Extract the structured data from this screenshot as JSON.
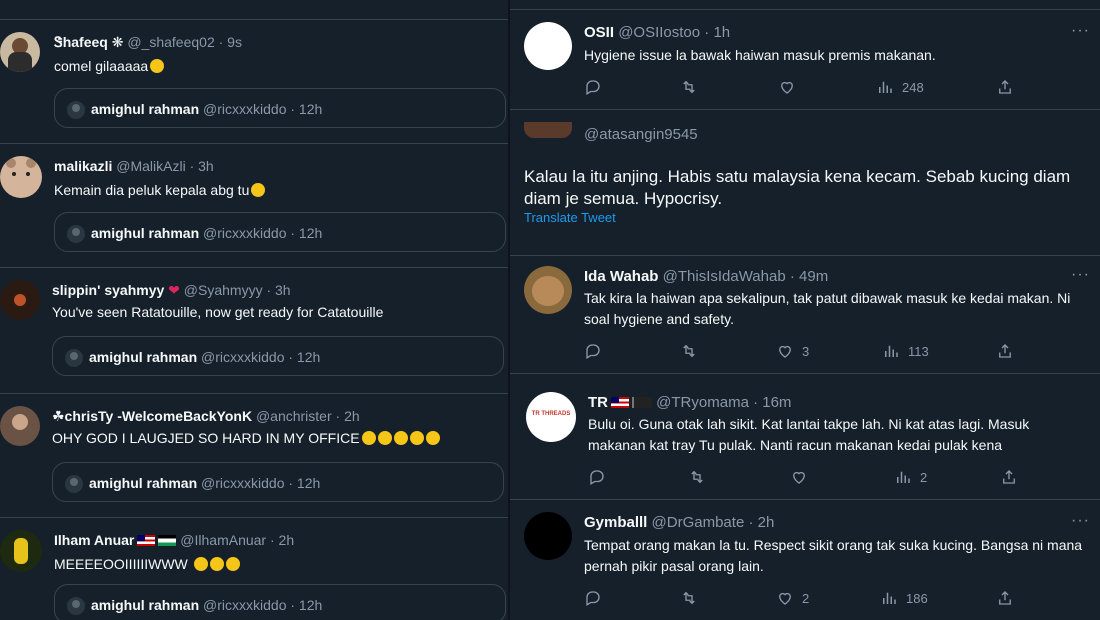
{
  "left_tweets": [
    {
      "name": "Ꮥhafeeq ❋",
      "handle": "@_shafeeq02 · 9s",
      "text": "comel gilaaaaa",
      "quote": {
        "name": "amighul rahman",
        "handle": "@ricxxxkiddo · 12h"
      }
    },
    {
      "name": "malikazli",
      "handle": "@MalikAzli · 3h",
      "text": "Kemain dia peluk kepala abg tu",
      "quote": {
        "name": "amighul rahman",
        "handle": "@ricxxxkiddo · 12h"
      }
    },
    {
      "name": "slippin' syahmyy",
      "handle": "@Syahmyyy · 3h",
      "text": "You've seen Ratatouille, now get ready for Catatouille",
      "quote": {
        "name": "amighul rahman",
        "handle": "@ricxxxkiddo · 12h"
      }
    },
    {
      "name": "☘chrisTy -WelcomeBackYonK",
      "handle": "@anchrister · 2h",
      "text": "OHY GOD I LAUGJED SO HARD IN MY OFFICE",
      "quote": {
        "name": "amighul rahman",
        "handle": "@ricxxxkiddo · 12h"
      }
    },
    {
      "name": "Ilham Anuar",
      "handle": "@IlhamAnuar · 2h",
      "text": "MEEEEOOIIIIIIWWW",
      "quote": {
        "name": "amighul rahman",
        "handle": "@ricxxxkiddo · 12h"
      }
    }
  ],
  "right": {
    "t1": {
      "name": "OSII",
      "handle": "@OSIIostoo · 1h",
      "text": "Hygiene issue la bawak haiwan masuk premis makanan.",
      "views": "248"
    },
    "t2": {
      "handle": "@atasangin9545",
      "text": "Kalau la itu anjing. Habis satu malaysia kena kecam. Sebab kucing diam diam je semua. Hypocrisy.",
      "translate": "Translate Tweet"
    },
    "t3": {
      "name": "Ida Wahab",
      "handle": "@ThisIsIdaWahab · 49m",
      "text": "Tak kira la haiwan apa sekalipun, tak patut dibawak masuk ke kedai makan. Ni soal hygiene and safety.",
      "likes": "3",
      "views": "113"
    },
    "t4": {
      "name": "TR",
      "handle": "@TRyomama · 16m",
      "avatar_text": "TR THREADS",
      "text": "Bulu oi. Guna otak lah sikit. Kat lantai takpe lah. Ni kat atas lagi. Masuk makanan kat tray Tu pulak. Nanti racun makanan kedai pulak kena",
      "views": "2"
    },
    "t5": {
      "name": "Gymballl",
      "handle": "@DrGambate · 2h",
      "text": "Tempat orang makan la tu. Respect sikit orang tak suka kucing. Bangsa ni mana pernah pikir pasal orang lain.",
      "likes": "2",
      "views": "186"
    }
  },
  "colors": {
    "bg": "#15202b",
    "text": "#f7f9f9",
    "muted": "#8b98a5",
    "link": "#1d9bf0",
    "border": "#38444d"
  },
  "icons": [
    "reply-icon",
    "retweet-icon",
    "like-icon",
    "views-icon",
    "share-icon",
    "more-icon"
  ]
}
